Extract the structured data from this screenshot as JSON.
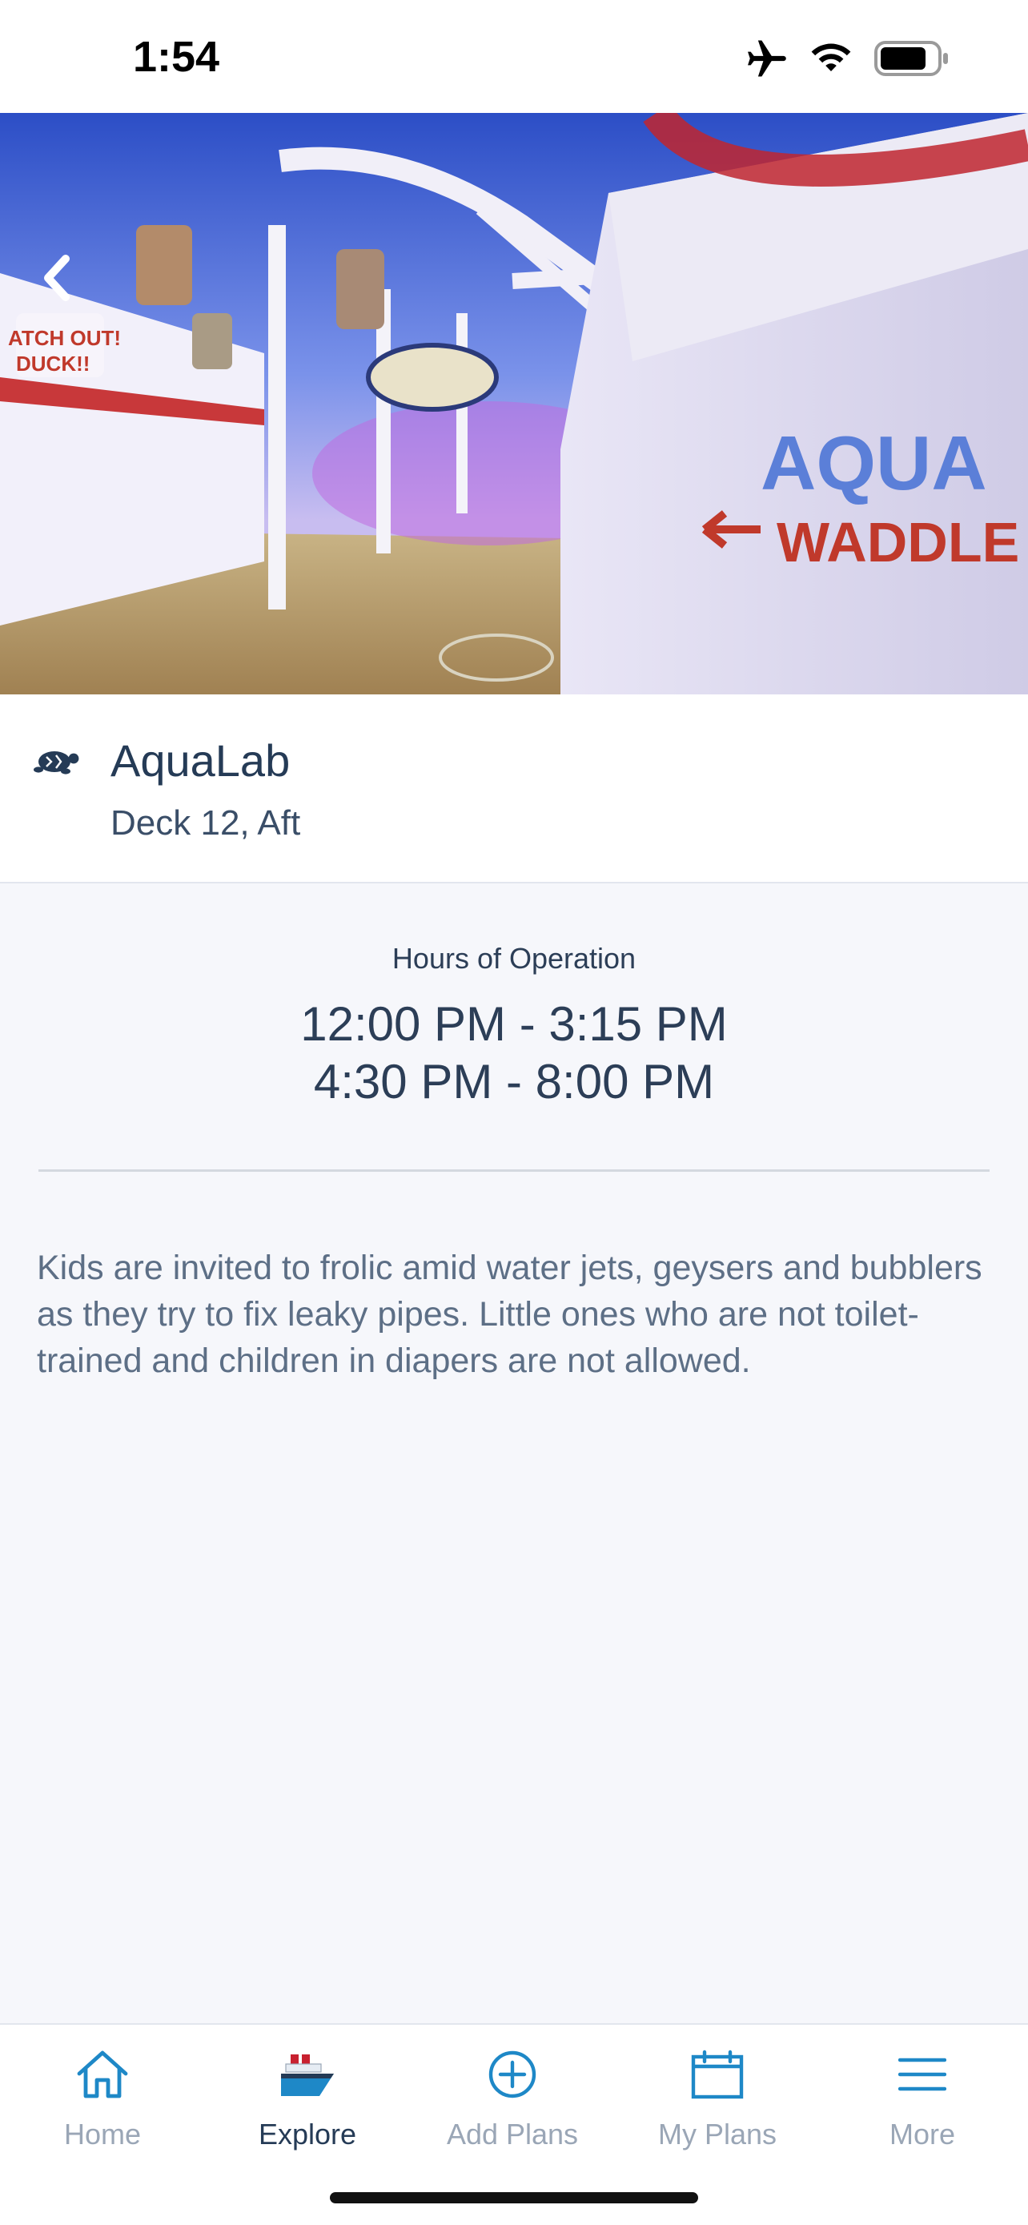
{
  "status_bar": {
    "time": "1:54",
    "icons": [
      "airplane-icon",
      "wifi-icon",
      "battery-icon"
    ]
  },
  "hero": {
    "image": "water play area with pipes and signs",
    "back_icon": "chevron-left-icon"
  },
  "venue": {
    "icon": "turtle-icon",
    "title": "AquaLab",
    "subtitle": "Deck 12, Aft"
  },
  "hours": {
    "label": "Hours of Operation",
    "lines": [
      "12:00 PM - 3:15 PM",
      "4:30 PM - 8:00 PM"
    ]
  },
  "description": "Kids are invited to frolic amid water jets, geysers and bubblers as they try to fix leaky pipes. Little ones who are not toilet-trained and children in diapers are not allowed.",
  "tab_bar": {
    "tabs": [
      {
        "label": "Home",
        "icon": "home-icon"
      },
      {
        "label": "Explore",
        "icon": "ship-icon",
        "active": true
      },
      {
        "label": "Add Plans",
        "icon": "plus-circle-icon"
      },
      {
        "label": "My Plans",
        "icon": "calendar-icon"
      },
      {
        "label": "More",
        "icon": "menu-icon"
      }
    ]
  },
  "colors": {
    "text_primary": "#253b56",
    "tab_accent": "#1e88c7",
    "tab_inactive": "#9aa6b6",
    "ship_red": "#c8202f"
  }
}
